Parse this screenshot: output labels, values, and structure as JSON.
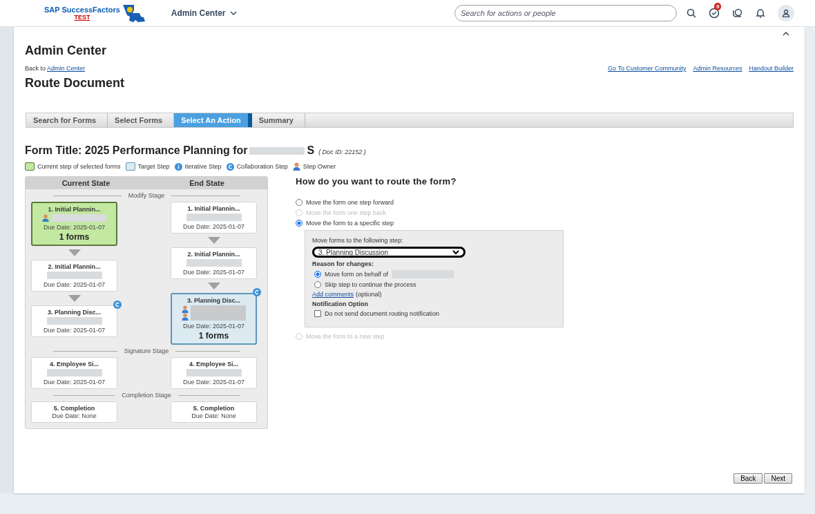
{
  "header": {
    "brand": "SAP SuccessFactors",
    "env": "TEST",
    "menu": "Admin Center",
    "search": {
      "placeholder": "Search for actions or people"
    },
    "badge": "9"
  },
  "page": {
    "title": "Admin Center",
    "back_prefix": "Back to",
    "back_link": "Admin Center",
    "links": [
      "Go To Customer Community",
      "Admin Resources",
      "Handout Builder"
    ],
    "subtitle": "Route Document"
  },
  "wizard": [
    {
      "label": "Search for Forms",
      "selected": false
    },
    {
      "label": "Select Forms",
      "selected": false
    },
    {
      "label": "Select An Action",
      "selected": true
    },
    {
      "label": "Summary",
      "selected": false
    }
  ],
  "form_title": "Form Title: 2025 Performance Planning for",
  "form_title_end": "S",
  "doc_id": "( Doc ID: 22152 )",
  "legend": [
    {
      "kind": "current",
      "label": "Current step of selected forms"
    },
    {
      "kind": "target",
      "label": "Target Step"
    },
    {
      "kind": "iterative",
      "label": "Iterative Step"
    },
    {
      "kind": "collaboration",
      "label": "Collaboration Step"
    },
    {
      "kind": "owner",
      "label": "Step Owner"
    }
  ],
  "columns": [
    "Current State",
    "End State"
  ],
  "stages": [
    {
      "name": "Modify Stage",
      "current": [
        {
          "title": "1. Initial Plannin...",
          "current_step": true,
          "target_step": false,
          "owner": true,
          "co_owner": false,
          "collaboration": false,
          "redacted": true,
          "due": "Due Date: 2025-01-07",
          "forms": "1 forms"
        },
        {
          "title": "2. Initial Plannin...",
          "current_step": false,
          "target_step": false,
          "owner": false,
          "co_owner": false,
          "collaboration": false,
          "redacted": true,
          "due": "Due Date: 2025-01-07"
        },
        {
          "title": "3. Planning Disc...",
          "current_step": false,
          "target_step": false,
          "owner": false,
          "co_owner": false,
          "collaboration": true,
          "redacted": true,
          "due": "Due Date: 2025-01-07"
        }
      ],
      "end": [
        {
          "title": "1. Initial Plannin...",
          "current_step": false,
          "target_step": false,
          "owner": false,
          "co_owner": false,
          "collaboration": false,
          "redacted": true,
          "due": "Due Date: 2025-01-07"
        },
        {
          "title": "2. Initial Plannin...",
          "current_step": false,
          "target_step": false,
          "owner": false,
          "co_owner": false,
          "collaboration": false,
          "redacted": true,
          "due": "Due Date: 2025-01-07"
        },
        {
          "title": "3. Planning Disc...",
          "current_step": false,
          "target_step": true,
          "owner": true,
          "co_owner": true,
          "collaboration": true,
          "redacted": true,
          "due": "Due Date: 2025-01-07",
          "forms": "1 forms"
        }
      ]
    },
    {
      "name": "Signature Stage",
      "current": [
        {
          "title": "4. Employee Si...",
          "current_step": false,
          "target_step": false,
          "owner": false,
          "co_owner": false,
          "collaboration": false,
          "redacted": true,
          "due": "Due Date: 2025-01-07"
        }
      ],
      "end": [
        {
          "title": "4. Employee Si...",
          "current_step": false,
          "target_step": false,
          "owner": false,
          "co_owner": false,
          "collaboration": false,
          "redacted": true,
          "due": "Due Date: 2025-01-07"
        }
      ]
    },
    {
      "name": "Completion Stage",
      "current": [
        {
          "title": "5. Completion",
          "current_step": false,
          "target_step": false,
          "owner": false,
          "co_owner": false,
          "collaboration": false,
          "redacted": false,
          "due": "Due Date: None"
        }
      ],
      "end": [
        {
          "title": "5. Completion",
          "current_step": false,
          "target_step": false,
          "owner": false,
          "co_owner": false,
          "collaboration": false,
          "redacted": false,
          "due": "Due Date: None"
        }
      ]
    }
  ],
  "route": {
    "question": "How do you want to route the form?",
    "options": [
      {
        "label": "Move the form one step forward",
        "selected": false,
        "disabled": false
      },
      {
        "label": "Move the form one step back",
        "selected": false,
        "disabled": true
      },
      {
        "label": "Move the form to a specific step",
        "selected": true,
        "disabled": false
      },
      {
        "label": "Move the form to a new step",
        "selected": false,
        "disabled": true
      }
    ],
    "step_label": "Move forms to the following step:",
    "step_value": "3. Planning Discussion",
    "reason_label": "Reason for changes:",
    "reasons": [
      {
        "label": "Move form on behalf of",
        "selected": true,
        "redacted": true
      },
      {
        "label": "Skip step to continue the process",
        "selected": false,
        "redacted": false
      }
    ],
    "comments_link": "Add comments",
    "comments_note": "(optional)",
    "notify_label": "Notification Option",
    "notify_checkbox": {
      "label": "Do not send document routing notification",
      "checked": false
    }
  },
  "buttons": [
    "Back",
    "Next"
  ]
}
